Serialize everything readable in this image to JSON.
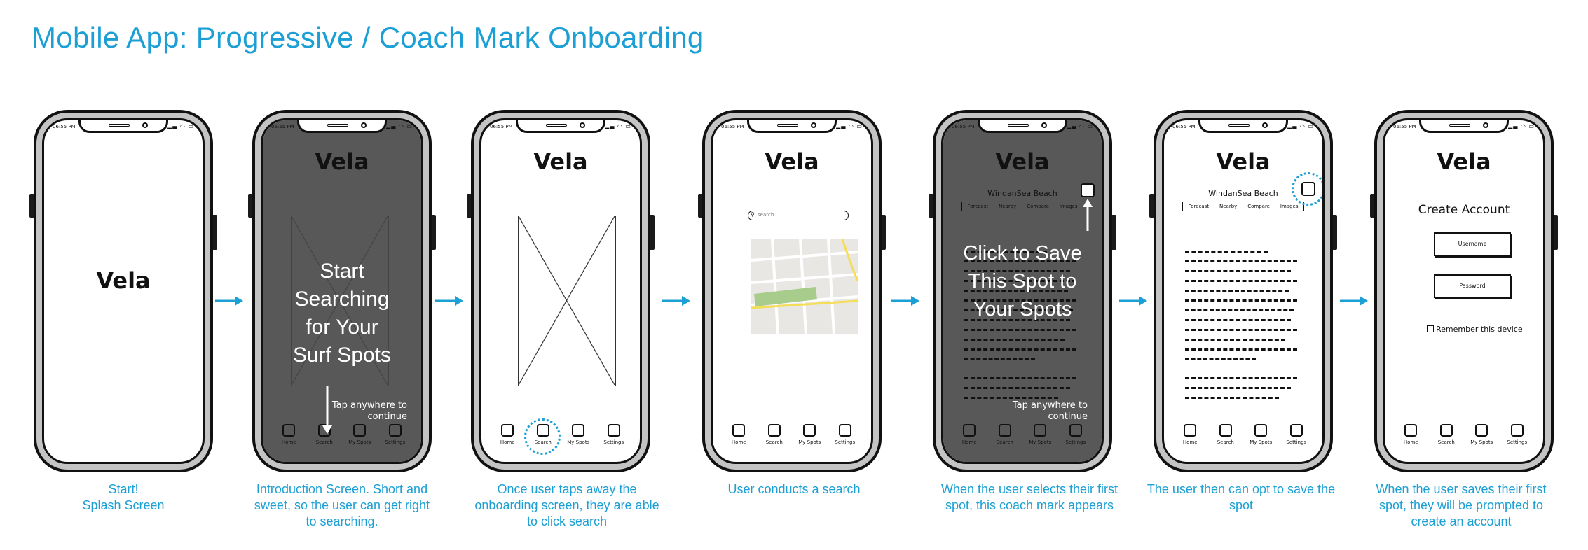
{
  "title": "Mobile App: Progressive / Coach Mark Onboarding",
  "colors": {
    "accent": "#1b9fd4",
    "overlay": "#4a4a4a",
    "ink": "#111111"
  },
  "status_time": "06:55 PM",
  "app_name": "Vela",
  "tabs": [
    "Home",
    "Search",
    "My Spots",
    "Settings"
  ],
  "search_placeholder": "search",
  "spot": {
    "name": "WindanSea Beach",
    "tabs": [
      "Forecast",
      "Nearby",
      "Compare",
      "Images"
    ]
  },
  "coach": {
    "intro_text": "Start Searching for Your Surf Spots",
    "save_text": "Click to Save This Spot to Your Spots",
    "hint": "Tap anywhere to continue"
  },
  "create_account": {
    "title": "Create Account",
    "username": "Username",
    "password": "Password",
    "remember": "Remember this device"
  },
  "captions": [
    "Start!\nSplash Screen",
    "Introduction Screen.  Short and sweet, so the user can get right to searching.",
    "Once user taps away the onboarding screen, they are able to click search",
    "User conducts a search",
    "When the user selects their first spot, this coach mark appears",
    "The user then can opt to save the spot",
    "When the user saves their first spot, they will be prompted to create an account"
  ]
}
